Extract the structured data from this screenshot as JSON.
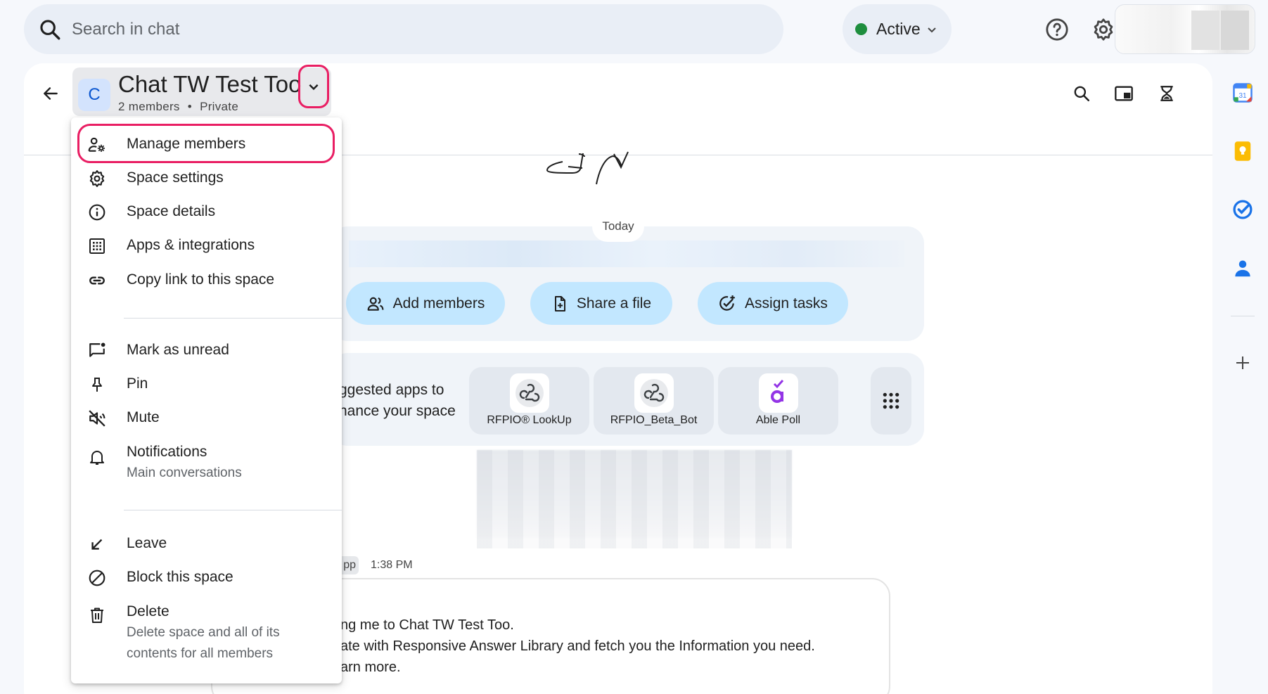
{
  "search": {
    "placeholder": "Search in chat"
  },
  "status": {
    "label": "Active",
    "color": "#1e8e3e"
  },
  "top_icons": [
    "help-icon",
    "settings-icon",
    "apps-grid-icon"
  ],
  "space": {
    "avatar_letter": "C",
    "name": "Chat TW Test Too",
    "members": "2 members",
    "separator": "•",
    "visibility": "Private"
  },
  "header_icons": [
    "search-icon",
    "picture-in-picture-icon",
    "hourglass-icon"
  ],
  "menu": {
    "items": [
      {
        "label": "Manage members",
        "icon": "manage-members-icon"
      },
      {
        "label": "Space settings",
        "icon": "gear-icon"
      },
      {
        "label": "Space details",
        "icon": "info-icon"
      },
      {
        "label": "Apps & integrations",
        "icon": "apps-icon"
      },
      {
        "label": "Copy link to this space",
        "icon": "link-icon"
      },
      {
        "label": "Mark as unread",
        "icon": "mark-unread-icon"
      },
      {
        "label": "Pin",
        "icon": "pin-icon"
      },
      {
        "label": "Mute",
        "icon": "mute-icon"
      },
      {
        "label": "Notifications",
        "sublabel": "Main conversations",
        "icon": "bell-icon"
      },
      {
        "label": "Leave",
        "icon": "leave-arrow-icon"
      },
      {
        "label": "Block this space",
        "icon": "block-icon"
      },
      {
        "label": "Delete",
        "sublabel1": "Delete space and all of its",
        "sublabel2": "contents for all members",
        "icon": "trash-icon"
      }
    ]
  },
  "chat": {
    "date_divider": "Today",
    "actions": [
      {
        "label": "Add members"
      },
      {
        "label": "Share a file"
      },
      {
        "label": "Assign tasks"
      }
    ],
    "suggested_line1": "ggested apps to",
    "suggested_line2": "hance your space",
    "apps": [
      {
        "name": "RFPIO® LookUp"
      },
      {
        "name": "RFPIO_Beta_Bot"
      },
      {
        "name": "Able Poll"
      }
    ],
    "sender_fragment": "pp",
    "time": "1:38 PM",
    "message_lines": [
      "ng me to Chat TW Test Too.",
      "ate with Responsive Answer Library and fetch you the Information you need.",
      "arn more."
    ]
  },
  "colors": {
    "accent": "#0b57d0",
    "highlight": "#e91e63",
    "pill": "#c2e7ff"
  }
}
